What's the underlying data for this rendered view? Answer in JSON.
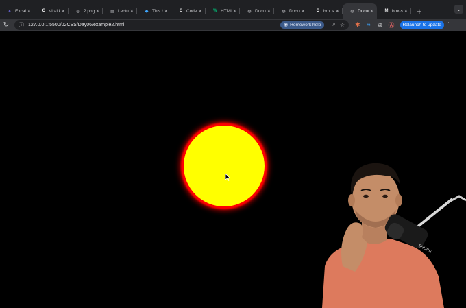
{
  "browser": {
    "tabs": [
      {
        "title": "Excalid",
        "favicon": "excalidraw-icon",
        "color": "#6965db",
        "glyph": "✕",
        "active": false
      },
      {
        "title": "viral k",
        "favicon": "google-icon",
        "color": "#ffffff",
        "glyph": "G",
        "active": false
      },
      {
        "title": "2.png",
        "favicon": "globe-icon",
        "color": "#8a8b8f",
        "glyph": "◍",
        "active": false
      },
      {
        "title": "Lectur",
        "favicon": "page-icon",
        "color": "#8a8b8f",
        "glyph": "▤",
        "active": false
      },
      {
        "title": "This is",
        "favicon": "vscode-icon",
        "color": "#3ea6ff",
        "glyph": "◆",
        "active": false
      },
      {
        "title": "Coder",
        "favicon": "coder-icon",
        "color": "#e8e8ea",
        "glyph": "C",
        "active": false
      },
      {
        "title": "HTML",
        "favicon": "w3schools-icon",
        "color": "#04aa6d",
        "glyph": "W",
        "active": false
      },
      {
        "title": "Docum",
        "favicon": "globe-icon",
        "color": "#8a8b8f",
        "glyph": "◍",
        "active": false
      },
      {
        "title": "Docum",
        "favicon": "globe-icon",
        "color": "#8a8b8f",
        "glyph": "◍",
        "active": false
      },
      {
        "title": "box sh",
        "favicon": "google-icon",
        "color": "#ffffff",
        "glyph": "G",
        "active": false
      },
      {
        "title": "Docum",
        "favicon": "globe-icon",
        "color": "#8a8b8f",
        "glyph": "◍",
        "active": true
      },
      {
        "title": "box-sh",
        "favicon": "mdn-icon",
        "color": "#e8e8ea",
        "glyph": "M",
        "active": false
      }
    ],
    "new_tab": "+",
    "tab_menu": "⌄",
    "address": "127.0.0.1:5500/02CSS/Day06/example2.html",
    "homework_label": "Homework help",
    "relaunch_label": "Relaunch to update",
    "accent": "#1a73e8"
  },
  "page": {
    "background": "#000000",
    "circle_fill": "#ffff00",
    "circle_glow": "#ff0000"
  }
}
